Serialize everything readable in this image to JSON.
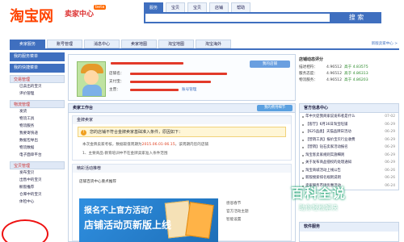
{
  "header": {
    "logo": "淘宝网",
    "logo_sub": "卖家中心",
    "beta": "beta",
    "search_tabs": [
      "服务",
      "宝贝",
      "宝贝",
      "店铺",
      "帮助"
    ],
    "search_placeholder": "",
    "search_button": "搜 索"
  },
  "nav": {
    "tabs": [
      "卖家服务",
      "账号管理",
      "消息中心",
      "卖家地图",
      "淘宝地图",
      "淘宝海外"
    ],
    "right_link": "新版卖家中心 >"
  },
  "sidebar": {
    "buttons": [
      "我的服务菜单",
      "我的快捷菜单"
    ],
    "groups": [
      {
        "title": "交易管理",
        "items": [
          "已卖出的宝贝",
          "评价管理"
        ]
      },
      {
        "title": "物流管理",
        "items": [
          "发货",
          "物流工具",
          "物流服务",
          "我要寄快递",
          "数据包导出",
          "物流数据",
          "电子面单平台"
        ]
      },
      {
        "title": "宝贝管理",
        "items": [
          "发布宝贝",
          "出售中的宝贝",
          "橱窗推荐",
          "仓库中的宝贝",
          "体检中心"
        ]
      }
    ]
  },
  "seller": {
    "shop_button": "我的店铺",
    "label_login": "店铺名：",
    "label_alipay": "支付宝：",
    "label_email": "主营：",
    "account_value": "账号管理"
  },
  "rating": {
    "title": "店铺动态评分",
    "rows": [
      {
        "label": "描述相符：",
        "value": "4.96512",
        "compare": "高于 4.83575"
      },
      {
        "label": "服务态度：",
        "value": "4.96512",
        "compare": "高于 4.86313"
      },
      {
        "label": "物流服务：",
        "value": "4.96512",
        "compare": "高于 4.86203"
      }
    ]
  },
  "workbench": {
    "title": "卖家工作台",
    "right_button": "我的费用细节",
    "section_title": "金牌卖家",
    "notice_pre": "您的店铺不符合金牌卖家基础准入条件，原因如下：",
    "note_line1": "本次金牌卖家考核，数据取值周期为",
    "note_date": "2015.06.01-06.15",
    "note_line1_post": "，该周期内您的店铺",
    "note_line2": "1、主要商品·教育培训中不在金牌卖家准入条件范围",
    "promo_title": "精彩活动推荐",
    "promo_sub": "店铺百货中心重点推荐",
    "banner_l1": "报名不上官方活动？",
    "banner_l2": "店铺活动页新版上线",
    "side_links": [
      "感恩春节",
      "官方活动主题",
      "智能设置"
    ]
  },
  "news": {
    "title": "官方信息中心",
    "items": [
      {
        "t": "年中大促我商家说发布者是什么",
        "d": "07-02"
      },
      {
        "t": "【客厅】6月16日淘宝旺铺",
        "d": "06-29"
      },
      {
        "t": "【625品类】天猫品牌日活动",
        "d": "06-29"
      },
      {
        "t": "【营销工具】报价宝贝行业收费",
        "d": "06-29"
      },
      {
        "t": "【营销】钻石卖家活动报名",
        "d": "06-29"
      },
      {
        "t": "淘宝客卖家规则实施细则",
        "d": "06-29"
      },
      {
        "t": "关于发布商品侵权的处理通知",
        "d": "06-29"
      },
      {
        "t": "淘宝商城活动上线公告",
        "d": "06-26"
      },
      {
        "t": "新版搜索排名规则说明",
        "d": "06-26"
      },
      {
        "t": "卖家服务市场优惠活动",
        "d": "06-24"
      }
    ]
  },
  "software": {
    "title": "软件服务"
  },
  "watermark": {
    "main": "百科全说",
    "sub": "助你轻松解决"
  },
  "colors": {
    "brand": "#ff4400",
    "accent": "#3f6fbf",
    "annotation": "#ee1111"
  }
}
